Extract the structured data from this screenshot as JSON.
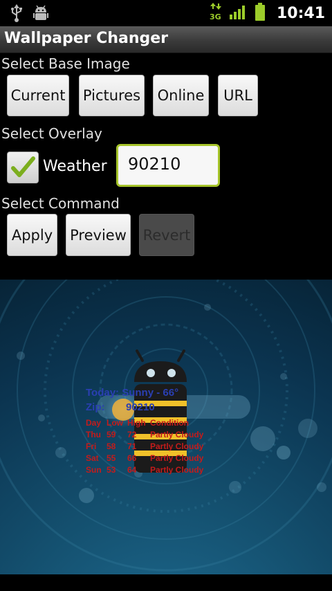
{
  "status_bar": {
    "time": "10:41",
    "network": "3G",
    "icons": [
      "usb-icon",
      "android-debug-icon",
      "data-3g-icon",
      "signal-icon",
      "battery-icon"
    ]
  },
  "app": {
    "title": "Wallpaper Changer"
  },
  "base_image": {
    "label": "Select Base Image",
    "buttons": [
      "Current",
      "Pictures",
      "Online",
      "URL"
    ]
  },
  "overlay": {
    "label": "Select Overlay",
    "weather_label": "Weather",
    "weather_checked": true,
    "zip_value": "90210"
  },
  "command": {
    "label": "Select Command",
    "buttons": [
      "Apply",
      "Preview",
      "Revert"
    ],
    "revert_enabled": false
  },
  "preview": {
    "today": "Today: Sunny - 66°",
    "zip_label": "Zip:",
    "zip_value": "90210",
    "forecast_header": [
      "Day",
      "Low",
      "High",
      "Condition"
    ],
    "forecast": [
      [
        "Thu",
        "59",
        "72",
        "Partly Cloudy"
      ],
      [
        "Fri",
        "58",
        "71",
        "Partly Cloudy"
      ],
      [
        "Sat",
        "55",
        "66",
        "Partly Cloudy"
      ],
      [
        "Sun",
        "53",
        "64",
        "Partly Cloudy"
      ]
    ]
  },
  "colors": {
    "accent_focus": "#a6c42a",
    "checkmark": "#7cae1e",
    "overlay_blue": "#2a3fb2",
    "overlay_red": "#c41b1b"
  }
}
